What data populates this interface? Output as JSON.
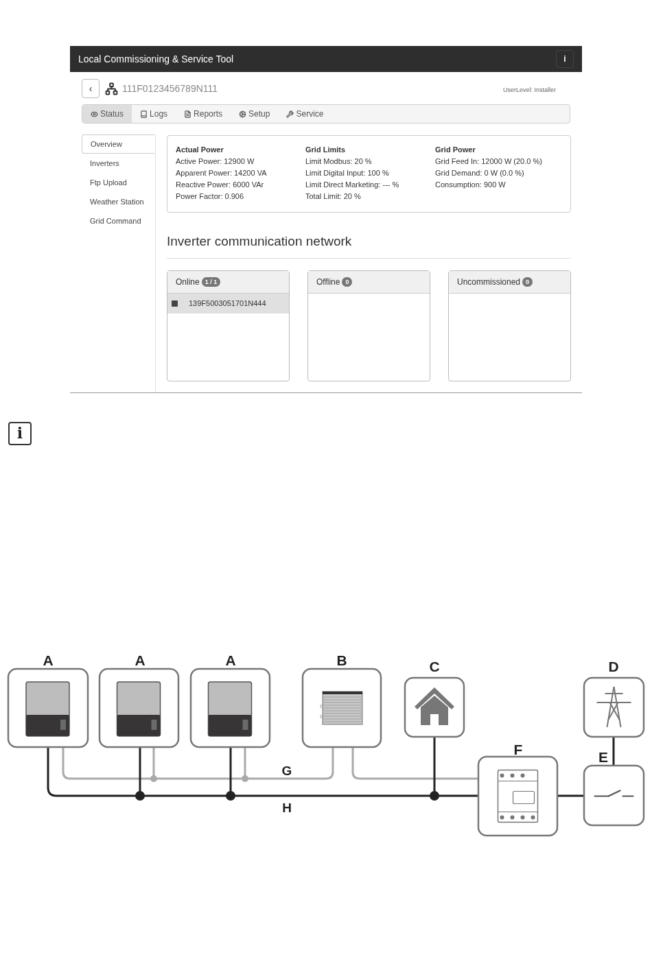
{
  "window": {
    "title": "Local Commissioning & Service Tool",
    "info_button": "i"
  },
  "header": {
    "back_button": "‹",
    "device_id": "111F0123456789N111",
    "user_level": "UserLevel: Installer"
  },
  "tabs": [
    {
      "label": "Status",
      "selected": true
    },
    {
      "label": "Logs",
      "selected": false
    },
    {
      "label": "Reports",
      "selected": false
    },
    {
      "label": "Setup",
      "selected": false
    },
    {
      "label": "Service",
      "selected": false
    }
  ],
  "sidebar": {
    "items": [
      {
        "label": "Overview",
        "selected": true
      },
      {
        "label": "Inverters",
        "selected": false
      },
      {
        "label": "Ftp Upload",
        "selected": false
      },
      {
        "label": "Weather Station",
        "selected": false
      },
      {
        "label": "Grid Command",
        "selected": false
      }
    ]
  },
  "summary": [
    {
      "title": "Actual Power",
      "lines": [
        "Active Power: 12900 W",
        "Apparent Power: 14200 VA",
        "Reactive Power: 6000 VAr",
        "Power Factor: 0.906"
      ]
    },
    {
      "title": "Grid Limits",
      "lines": [
        "Limit Modbus: 20 %",
        "Limit Digital Input: 100 %",
        "Limit Direct Marketing: --- %",
        "Total Limit: 20 %"
      ]
    },
    {
      "title": "Grid Power",
      "lines": [
        "Grid Feed In: 12000 W (20.0 %)",
        "Grid Demand: 0 W (0.0 %)",
        "Consumption: 900 W"
      ]
    }
  ],
  "network": {
    "title": "Inverter communication network",
    "panels": [
      {
        "title": "Online",
        "count": "1 / 1",
        "devices": [
          {
            "id": "139F5003051701N444",
            "selected": true
          }
        ]
      },
      {
        "title": "Offline",
        "count": "0"
      },
      {
        "title": "Uncommissioned",
        "count": "0"
      }
    ]
  },
  "note": {
    "icon": "i"
  },
  "diagram": {
    "nodes": [
      {
        "label": "A",
        "kind": "inverter"
      },
      {
        "label": "A",
        "kind": "inverter"
      },
      {
        "label": "A",
        "kind": "inverter"
      },
      {
        "label": "B",
        "kind": "datalogger"
      },
      {
        "label": "C",
        "kind": "house"
      },
      {
        "label": "D",
        "kind": "grid"
      },
      {
        "label": "F",
        "kind": "meter"
      },
      {
        "label": "E",
        "kind": "switch"
      }
    ],
    "cables": [
      {
        "label": "G",
        "kind": "communication"
      },
      {
        "label": "H",
        "kind": "power"
      }
    ]
  }
}
